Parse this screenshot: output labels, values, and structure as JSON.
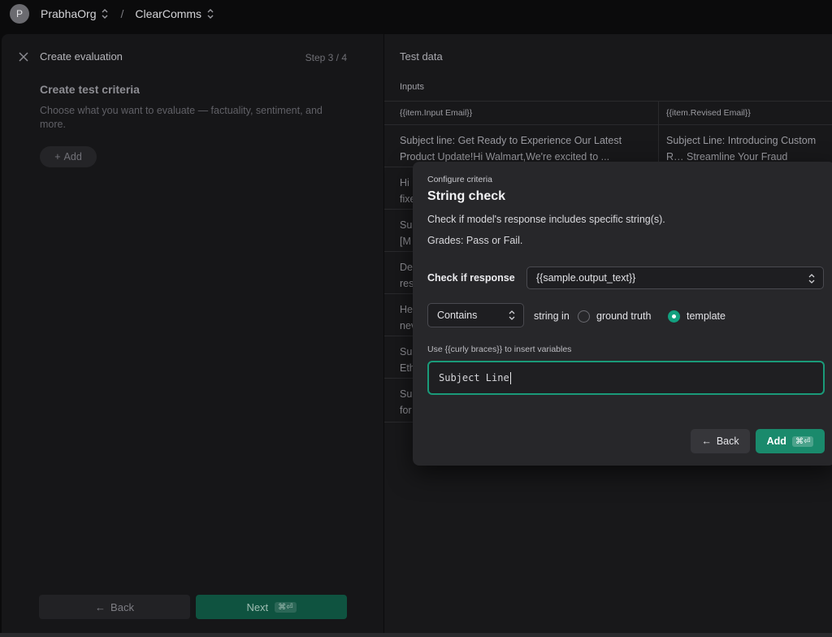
{
  "topbar": {
    "avatar_initial": "P",
    "org": "PrabhaOrg",
    "separator": "/",
    "project": "ClearComms"
  },
  "left": {
    "title": "Create evaluation",
    "step": "Step 3 / 4",
    "criteria_title": "Create test criteria",
    "criteria_desc": "Choose what you want to evaluate — factuality, sentiment, and more.",
    "add_label": "Add",
    "back_label": "Back",
    "next_label": "Next",
    "next_kbd": "⌘⏎"
  },
  "right": {
    "title": "Test data",
    "inputs_label": "Inputs",
    "columns": [
      "{{item.Input Email}}",
      "{{item.Revised Email}}"
    ],
    "rows": [
      {
        "c1": "Subject line: Get Ready to Experience Our Latest Product Update!Hi Walmart,We're excited to ...",
        "c2": "Subject Line: Introducing Custom R… Streamline Your Fraud DetectionHi"
      },
      {
        "c1": "Hi fixe",
        "c2": ""
      },
      {
        "c1": "Su [M",
        "c2": ""
      },
      {
        "c1": "De res",
        "c2": ""
      },
      {
        "c1": "He nev",
        "c2": ""
      },
      {
        "c1": "Su Eth",
        "c2": ""
      },
      {
        "c1": "Su for",
        "c2": ""
      }
    ]
  },
  "modal": {
    "subtitle": "Configure criteria",
    "title": "String check",
    "description": "Check if model's response includes specific string(s).",
    "grades": "Grades: Pass or Fail.",
    "check_label": "Check if response",
    "response_value": "{{sample.output_text}}",
    "operator_value": "Contains",
    "string_in": "string in",
    "radio_ground_truth": "ground truth",
    "radio_template": "template",
    "selected_radio": "template",
    "hint": "Use {{curly braces}} to insert variables",
    "template_value": "Subject Line",
    "back_label": "Back",
    "add_label": "Add",
    "add_kbd": "⌘⏎"
  },
  "colors": {
    "accent": "#1a8a6c",
    "focus_border": "#1a9a79",
    "next_button": "#0f5340"
  }
}
